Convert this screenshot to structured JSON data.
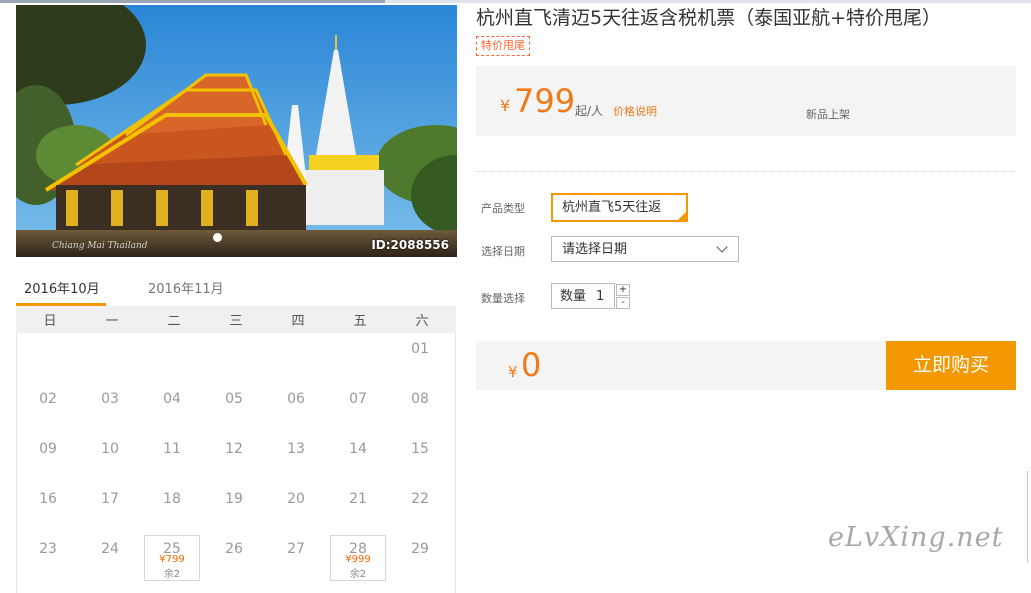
{
  "product": {
    "title": "杭州直飞清迈5天往返含税机票（泰国亚航+特价甩尾）",
    "tag": "特价甩尾",
    "image_id": "ID:2088556",
    "image_signature": "Chiang Mai Thailand"
  },
  "price": {
    "currency": "¥",
    "value": "799",
    "unit": "起/人",
    "note": "价格说明",
    "new_label": "新品上架"
  },
  "form": {
    "product_type_label": "产品类型",
    "product_type_value": "杭州直飞5天往返",
    "date_label": "选择日期",
    "date_value": "请选择日期",
    "quantity_label": "数量选择",
    "quantity_prefix": "数量",
    "quantity_value": "1",
    "plus": "+",
    "minus": "-"
  },
  "total": {
    "currency": "¥",
    "value": "0"
  },
  "buy_button": "立即购买",
  "calendar": {
    "tabs": [
      "2016年10月",
      "2016年11月"
    ],
    "active_tab": 0,
    "weekdays": [
      "日",
      "一",
      "二",
      "三",
      "四",
      "五",
      "六"
    ],
    "weeks": [
      [
        "",
        "",
        "",
        "",
        "",
        "",
        "01"
      ],
      [
        "02",
        "03",
        "04",
        "05",
        "06",
        "07",
        "08"
      ],
      [
        "09",
        "10",
        "11",
        "12",
        "13",
        "14",
        "15"
      ],
      [
        "16",
        "17",
        "18",
        "19",
        "20",
        "21",
        "22"
      ],
      [
        "23",
        "24",
        "25",
        "26",
        "27",
        "28",
        "29"
      ]
    ],
    "specials": [
      {
        "day": "25",
        "col": 2,
        "price": "¥799",
        "stock": "余2"
      },
      {
        "day": "28",
        "col": 5,
        "price": "¥999",
        "stock": "余2"
      }
    ]
  },
  "watermark": "eLvXing.net",
  "colors": {
    "accent": "#f39800",
    "price": "#f07a1a",
    "tag": "#ff6633"
  }
}
